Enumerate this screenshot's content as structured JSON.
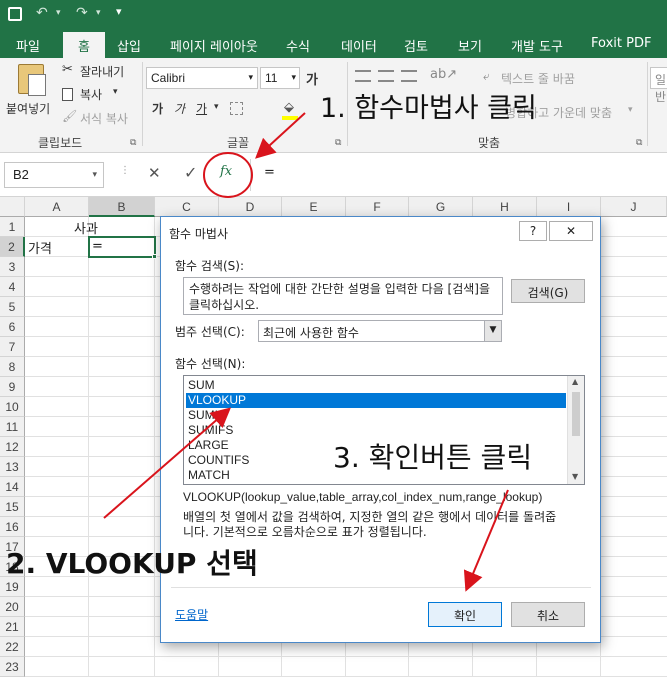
{
  "quick_access": {
    "down_arrow": "▾"
  },
  "tabs": [
    "파일",
    "홈",
    "삽입",
    "페이지 레이아웃",
    "수식",
    "데이터",
    "검토",
    "보기",
    "개발 도구",
    "Foxit PDF"
  ],
  "active_tab": "홈",
  "ribbon": {
    "clipboard": {
      "paste": "붙여넣기",
      "cut": "잘라내기",
      "copy": "복사",
      "format_painter": "서식 복사",
      "label": "클립보드"
    },
    "font": {
      "name": "Calibri",
      "size": "11",
      "label": "글꼴",
      "grow": "가",
      "shrink": "가",
      "bold": "가",
      "italic": "가",
      "underline": "가"
    },
    "align": {
      "wrap_text": "텍스트 줄 바꿈",
      "merge_hint": "병합하고 가운데 맞춤",
      "label": "맞춤"
    },
    "right_cut": "일반"
  },
  "formula_bar": {
    "name_box": "B2",
    "cancel": "✕",
    "enter": "✓",
    "fx": "fx",
    "content": "="
  },
  "grid": {
    "columns": [
      "A",
      "B",
      "C",
      "D",
      "E",
      "F",
      "G",
      "H",
      "I",
      "J"
    ],
    "rows": [
      "1",
      "2",
      "3",
      "4",
      "5",
      "6",
      "7",
      "8",
      "9",
      "10",
      "11",
      "12",
      "13",
      "14",
      "15",
      "16",
      "17",
      "18",
      "19",
      "20",
      "21",
      "22",
      "23"
    ],
    "cells": {
      "B1": "사과",
      "A2": "가격",
      "B2": "="
    }
  },
  "dialog": {
    "title": "함수 마법사",
    "help_btn": "?",
    "close_btn": "✕",
    "search_label": "함수 검색(S):",
    "search_text": "수행하려는 작업에 대한 간단한 설명을 입력한 다음 [검색]을 클릭하십시오.",
    "search_button": "검색(G)",
    "category_label": "범주 선택(C):",
    "category_value": "최근에 사용한 함수",
    "function_label": "함수 선택(N):",
    "functions": [
      "SUM",
      "VLOOKUP",
      "SUMIF",
      "SUMIFS",
      "LARGE",
      "COUNTIFS",
      "MATCH"
    ],
    "selected_function": "VLOOKUP",
    "signature": "VLOOKUP(lookup_value,table_array,col_index_num,range_lookup)",
    "description": "배열의 첫 열에서 값을 검색하여, 지정한 열의 같은 행에서 데이터를 돌려줍니다. 기본적으로 오름차순으로 표가 정렬됩니다.",
    "help_link": "도움말",
    "ok": "확인",
    "cancel": "취소"
  },
  "annotations": {
    "step1": "1. 함수마법사 클릭",
    "step2": "2. VLOOKUP 선택",
    "step3": "3. 확인버튼 클릭",
    "color_red": "#d9141c"
  },
  "colors": {
    "excel_green": "#217346",
    "selection_blue": "#0078d7"
  }
}
